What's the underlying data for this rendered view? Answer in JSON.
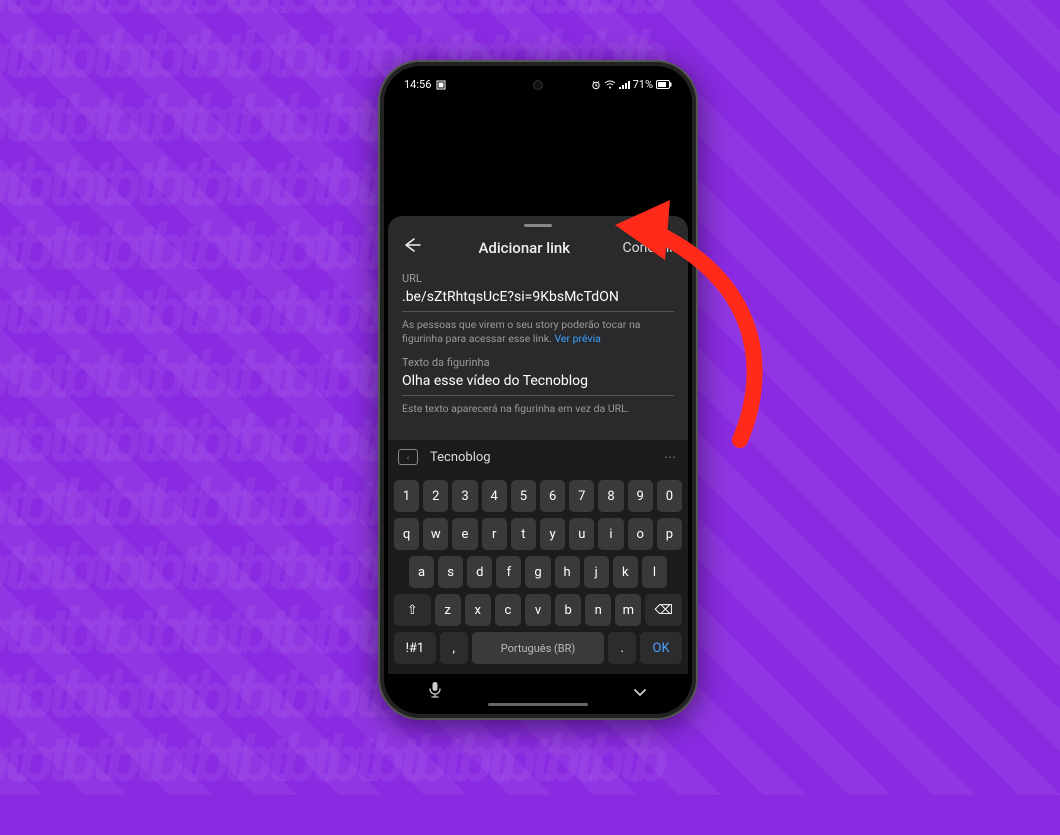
{
  "status": {
    "time": "14:56",
    "battery": "71%"
  },
  "sheet": {
    "title": "Adicionar link",
    "done": "Concluir",
    "url_label": "URL",
    "url_value": ".be/sZtRhtqsUcE?si=9KbsMcTdON",
    "url_hint_a": "As pessoas que virem o seu story poderão tocar na figurinha para acessar esse link. ",
    "url_preview": "Ver prévia",
    "sticker_label": "Texto da figurinha",
    "sticker_value": "Olha esse vídeo do Tecnoblog",
    "sticker_hint": "Este texto aparecerá na figurinha em vez da URL."
  },
  "keyboard": {
    "suggestion": "Tecnoblog",
    "row1": [
      "1",
      "2",
      "3",
      "4",
      "5",
      "6",
      "7",
      "8",
      "9",
      "0"
    ],
    "row2": [
      "q",
      "w",
      "e",
      "r",
      "t",
      "y",
      "u",
      "i",
      "o",
      "p"
    ],
    "row3": [
      "a",
      "s",
      "d",
      "f",
      "g",
      "h",
      "j",
      "k",
      "l"
    ],
    "row4_letters": [
      "z",
      "x",
      "c",
      "v",
      "b",
      "n",
      "m"
    ],
    "shift": "⇧",
    "backspace": "⌫",
    "symkey": "!#1",
    "comma": ",",
    "space": "Português (BR)",
    "period": ".",
    "ok": "OK"
  },
  "nav": {
    "mic": "🎤",
    "collapse": "⌄"
  }
}
